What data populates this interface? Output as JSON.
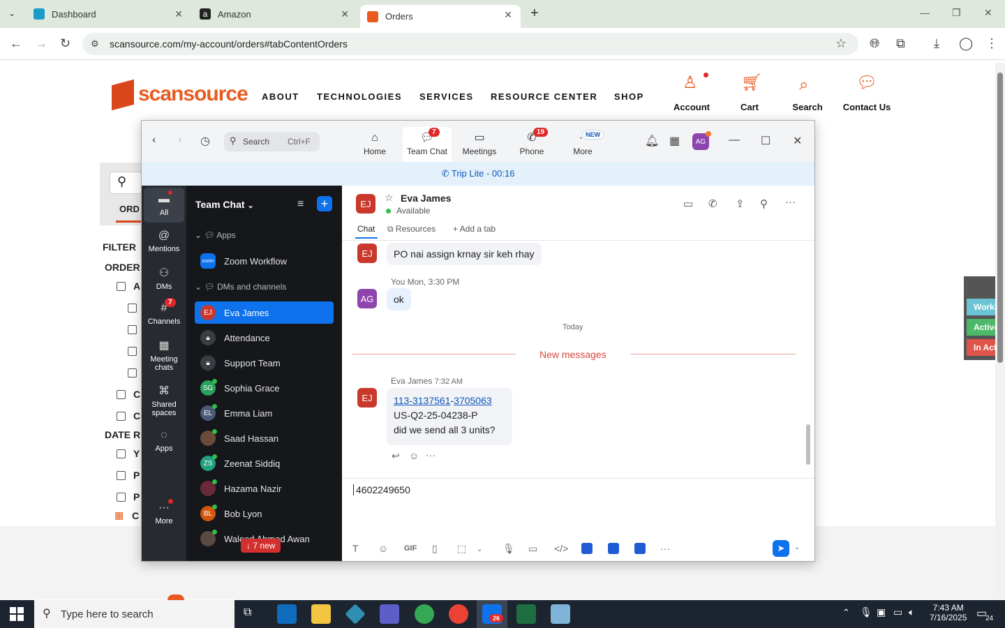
{
  "browser": {
    "tabs": [
      {
        "title": "Dashboard",
        "color": "#1a9cc9"
      },
      {
        "title": "Amazon",
        "color": "#222"
      },
      {
        "title": "Orders",
        "color": "#e85a1f"
      }
    ],
    "url": "scansource.com/my-account/orders#tabContentOrders"
  },
  "site": {
    "logo": "scansource",
    "nav": [
      "ABOUT",
      "TECHNOLOGIES",
      "SERVICES",
      "RESOURCE CENTER",
      "SHOP"
    ],
    "actions": [
      "Account",
      "Cart",
      "Search",
      "Contact Us"
    ],
    "tab_fragment": "ORD",
    "filter_label": "FILTER",
    "order_label": "ORDER",
    "date_label": "DATE R",
    "filter_letters": [
      "A",
      "C",
      "C",
      "Y",
      "P",
      "P",
      "C"
    ],
    "status": [
      "Working",
      "Active: (",
      "In Active"
    ]
  },
  "zoom": {
    "search_label": "Search",
    "search_shortcut": "Ctrl+F",
    "tabs": [
      {
        "label": "Home",
        "badge": ""
      },
      {
        "label": "Team Chat",
        "badge": "7"
      },
      {
        "label": "Meetings",
        "badge": ""
      },
      {
        "label": "Phone",
        "badge": "19"
      },
      {
        "label": "More",
        "badge": "NEW"
      }
    ],
    "avatar": "AG",
    "trip_bar": "Trip  Lite - 00:16",
    "rail": [
      {
        "label": "All"
      },
      {
        "label": "Mentions"
      },
      {
        "label": "DMs"
      },
      {
        "label": "Channels",
        "badge": "7"
      },
      {
        "label": "Meeting chats"
      },
      {
        "label": "Shared spaces"
      },
      {
        "label": "Apps"
      },
      {
        "label": "More"
      }
    ],
    "list_title": "Team Chat",
    "sections": [
      "Apps",
      "DMs and channels"
    ],
    "apps": [
      {
        "name": "Zoom Workflow"
      }
    ],
    "contacts": [
      {
        "name": "Eva James",
        "initials": "EJ",
        "color": "#c9382b"
      },
      {
        "name": "Attendance",
        "initials": "",
        "color": "#3a3d44"
      },
      {
        "name": "Support Team",
        "initials": "",
        "color": "#3a3d44"
      },
      {
        "name": "Sophia Grace",
        "initials": "SG",
        "color": "#2aa05a"
      },
      {
        "name": "Emma Liam",
        "initials": "EL",
        "color": "#4a5a78"
      },
      {
        "name": "Saad Hassan",
        "initials": "",
        "color": "#6b4b3a"
      },
      {
        "name": "Zeenat Siddiq",
        "initials": "ZS",
        "color": "#20a07e"
      },
      {
        "name": "Hazama Nazir",
        "initials": "",
        "color": "#6a2a3a"
      },
      {
        "name": "Bob Lyon",
        "initials": "BL",
        "color": "#d2560f"
      },
      {
        "name": "Waleed Ahmed Awan",
        "initials": "",
        "color": "#5a4a40"
      }
    ],
    "new_pill": "↓ 7 new",
    "chat": {
      "name": "Eva James",
      "initials": "EJ",
      "status": "Available",
      "tabs": [
        "Chat",
        "Resources",
        "+ Add a tab"
      ],
      "messages": [
        {
          "text": "PO nai assign krnay sir keh rhay"
        },
        {
          "meta": "You Mon, 3:30 PM",
          "text": "ok",
          "initials": "AG"
        }
      ],
      "day_divider": "Today",
      "new_divider": "New messages",
      "latest": {
        "meta_name": "Eva James",
        "meta_time": "7:32 AM",
        "link1": "113-3137561",
        "dash": "-",
        "link2": "3705063",
        "line2": "US-Q2-25-04238-P",
        "line3": "did we send all 3 units?"
      },
      "composer_value": "4602249650",
      "toolbar_gif": "GIF"
    }
  },
  "taskbar": {
    "search_placeholder": "Type here to search",
    "time": "7:43 AM",
    "date": "7/16/2025",
    "notif_count": "24",
    "zoom_badge": "26"
  }
}
